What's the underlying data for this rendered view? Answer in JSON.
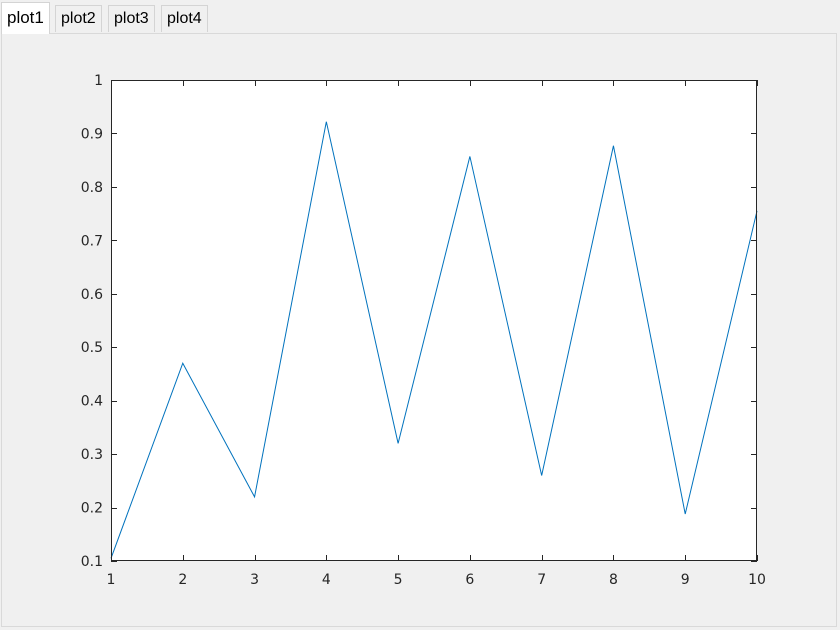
{
  "tabs": [
    {
      "label": "plot1",
      "active": true
    },
    {
      "label": "plot2",
      "active": false
    },
    {
      "label": "plot3",
      "active": false
    },
    {
      "label": "plot4",
      "active": false
    }
  ],
  "chart_data": {
    "type": "line",
    "x": [
      1,
      2,
      3,
      4,
      5,
      6,
      7,
      8,
      9,
      10
    ],
    "series": [
      {
        "values": [
          0.105,
          0.47,
          0.22,
          0.922,
          0.32,
          0.857,
          0.26,
          0.877,
          0.188,
          0.755
        ]
      }
    ],
    "xlim": [
      1,
      10
    ],
    "ylim": [
      0.1,
      1
    ],
    "xticks": [
      1,
      2,
      3,
      4,
      5,
      6,
      7,
      8,
      9,
      10
    ],
    "xtick_labels": [
      "1",
      "2",
      "3",
      "4",
      "5",
      "6",
      "7",
      "8",
      "9",
      "10"
    ],
    "yticks": [
      0.1,
      0.2,
      0.3,
      0.4,
      0.5,
      0.6,
      0.7,
      0.8,
      0.9,
      1
    ],
    "ytick_labels": [
      "0.1",
      "0.2",
      "0.3",
      "0.4",
      "0.5",
      "0.6",
      "0.7",
      "0.8",
      "0.9",
      "1"
    ],
    "grid": false,
    "line_color": "#0072bd",
    "axes_color": "#262626"
  }
}
